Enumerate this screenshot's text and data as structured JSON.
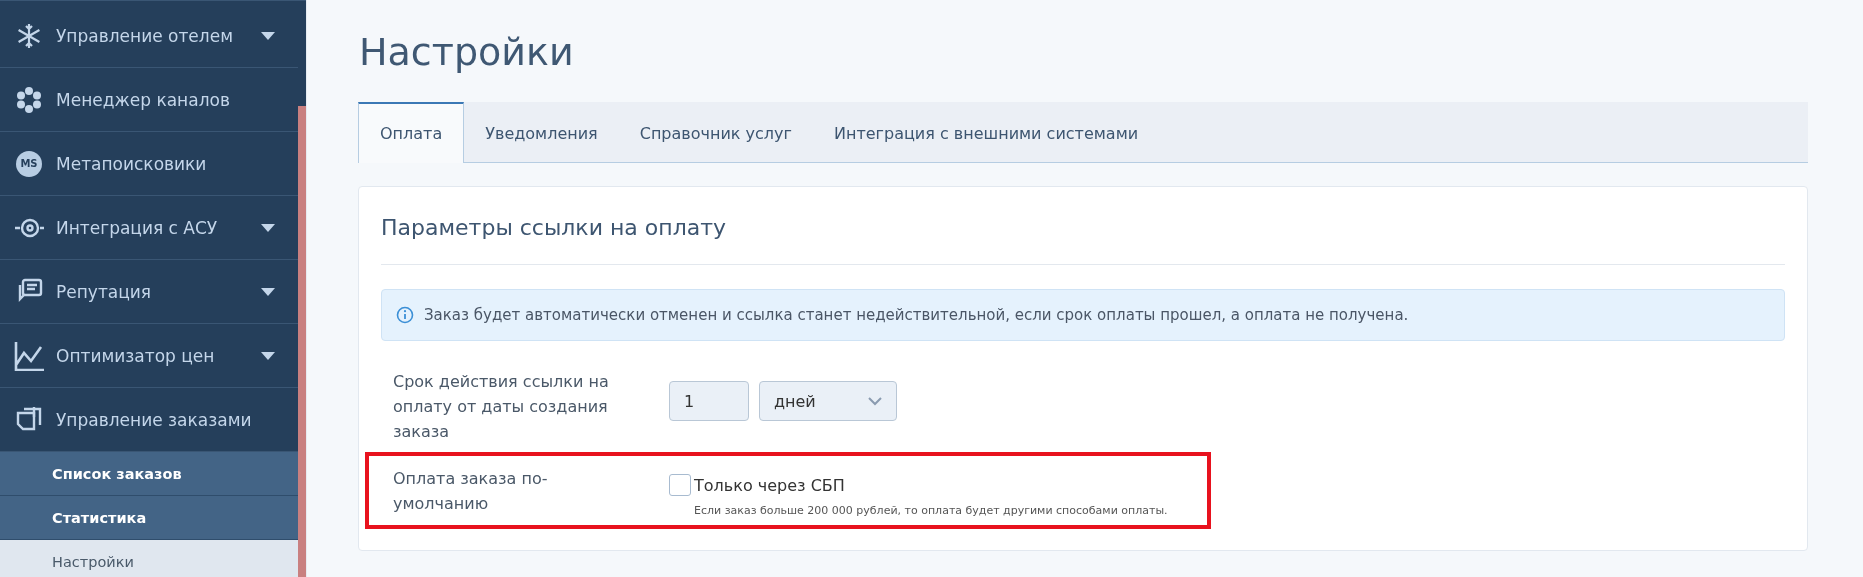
{
  "sidebar": {
    "items": [
      {
        "label": "Управление отелем",
        "expandable": true
      },
      {
        "label": "Менеджер каналов",
        "expandable": false
      },
      {
        "label": "Метапоисковики",
        "icon_text": "MS",
        "expandable": false
      },
      {
        "label": "Интеграция с АСУ",
        "expandable": true
      },
      {
        "label": "Репутация",
        "expandable": true
      },
      {
        "label": "Оптимизатор цен",
        "expandable": true
      },
      {
        "label": "Управление заказами",
        "expandable": false,
        "children": [
          {
            "label": "Список заказов",
            "selected": false
          },
          {
            "label": "Статистика",
            "selected": false
          },
          {
            "label": "Настройки",
            "selected": true
          }
        ]
      }
    ]
  },
  "page": {
    "title": "Настройки",
    "tabs": [
      {
        "label": "Оплата",
        "selected": true
      },
      {
        "label": "Уведомления",
        "selected": false
      },
      {
        "label": "Справочник услуг",
        "selected": false
      },
      {
        "label": "Интеграция с внешними системами",
        "selected": false
      }
    ],
    "card": {
      "title": "Параметры ссылки на оплату",
      "info": "Заказ будет автоматически отменен и ссылка станет недействительной, если срок оплаты прошел, а оплата не получена.",
      "rows": [
        {
          "kind": "period",
          "label": "Срок действия ссылки на оплату от даты создания заказа",
          "value": "1",
          "unit": "дней",
          "highlighted": false
        },
        {
          "kind": "checkbox",
          "label": "Оплата заказа по-умолчанию",
          "option": "Только через СБП",
          "checked": false,
          "hint": "Если заказ больше 200 000 рублей, то оплата будет другими способами оплаты.",
          "highlighted": true
        }
      ]
    }
  }
}
